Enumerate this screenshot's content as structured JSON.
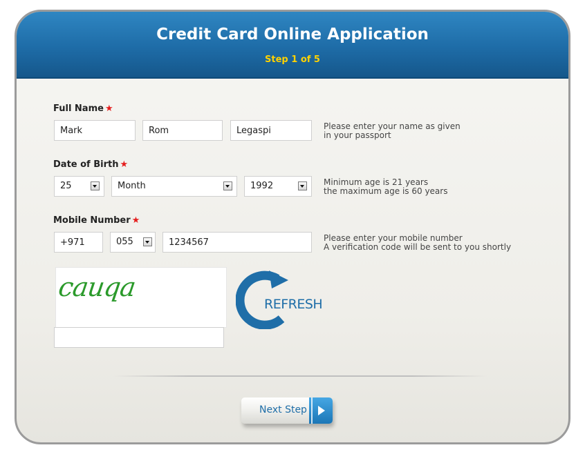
{
  "header": {
    "title": "Credit Card Online Application",
    "step": "Step 1 of 5"
  },
  "full_name": {
    "label": "Full Name",
    "first": "Mark",
    "middle": "Rom",
    "last": "Legaspi",
    "help_line1": "Please enter your name as given",
    "help_line2": "in your passport"
  },
  "date_of_birth": {
    "label": "Date of Birth",
    "day": "25",
    "month": "Month",
    "year": "1992",
    "help_line1": "Minimum age is 21 years",
    "help_line2": "the maximum age is 60 years"
  },
  "mobile": {
    "label": "Mobile Number",
    "country_code": "+971",
    "prefix": "055",
    "number": "1234567",
    "help_line1": "Please enter your mobile number",
    "help_line2": "A verification code will be sent to you shortly"
  },
  "captcha": {
    "text": "cauqa",
    "input_value": "",
    "refresh_label": "REFRESH"
  },
  "actions": {
    "next_label": "Next Step"
  },
  "colors": {
    "header_blue": "#1e6ca7",
    "step_yellow": "#ffd200",
    "required_star": "#e51d1d",
    "captcha_green": "#2b9a2b",
    "refresh_blue": "#1f6ea8"
  },
  "icons": {
    "required": "required-star-icon",
    "dropdown": "dropdown-arrow-icon",
    "refresh": "refresh-icon",
    "next": "next-arrow-icon"
  }
}
